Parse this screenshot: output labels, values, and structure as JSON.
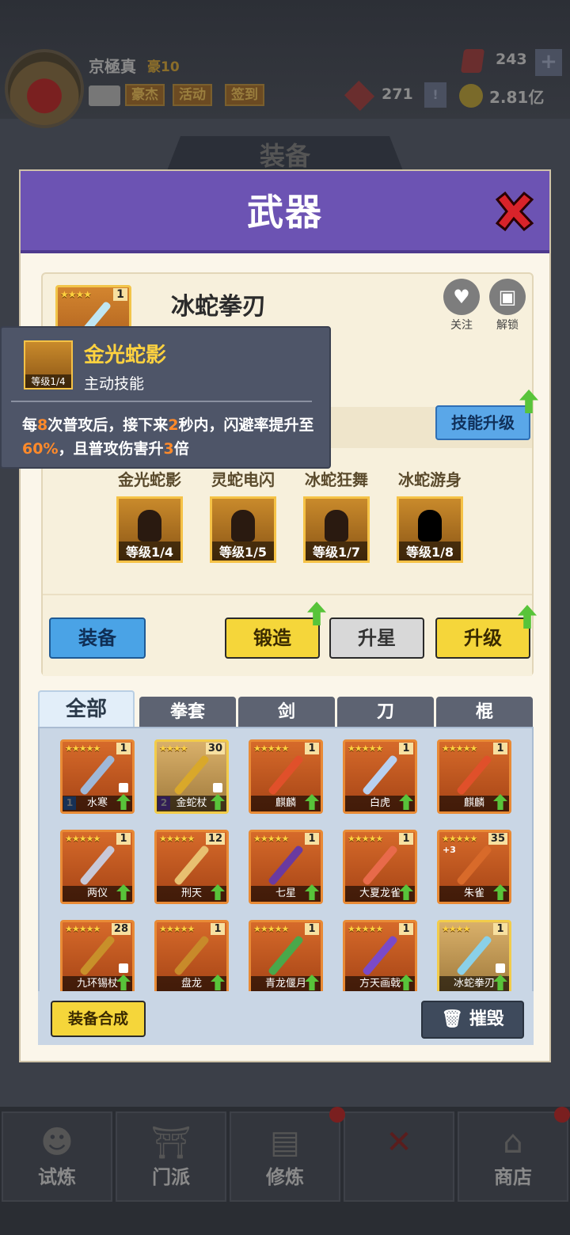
{
  "player": {
    "name": "京極真",
    "rank": "豪10",
    "tabs": [
      "豪杰",
      "活动",
      "签到"
    ]
  },
  "resources": {
    "gems": "243",
    "tickets": "271",
    "coins": "2.81亿"
  },
  "background": {
    "section_title": "装备",
    "nav": [
      "试炼",
      "门派",
      "修炼",
      "",
      "商店"
    ]
  },
  "modal": {
    "title": "武器",
    "item": {
      "name": "冰蛇拳刃",
      "stars": "★★★★",
      "qty": "1",
      "follow_label": "关注",
      "unlock_label": "解锁"
    },
    "skill_upgrade_label": "技能升级",
    "skills": [
      {
        "name": "金光蛇影",
        "level": "等级1/4"
      },
      {
        "name": "灵蛇电闪",
        "level": "等级1/5"
      },
      {
        "name": "冰蛇狂舞",
        "level": "等级1/7"
      },
      {
        "name": "冰蛇游身",
        "level": "等级1/8"
      }
    ],
    "buttons": {
      "equip": "装备",
      "forge": "锻造",
      "star": "升星",
      "upgrade": "升级"
    },
    "tabs": [
      "全部",
      "拳套",
      "剑",
      "刀",
      "棍"
    ],
    "weapons": [
      {
        "name": "水寒",
        "stars": "★★★★★",
        "qty": "1",
        "order": "1",
        "locked": true,
        "color": "#9fb8d8"
      },
      {
        "name": "金蛇杖",
        "stars": "★★★★",
        "qty": "30",
        "order": "2",
        "locked": true,
        "gold": true,
        "color": "#d9a82a"
      },
      {
        "name": "麒麟",
        "stars": "★★★★★",
        "qty": "1",
        "color": "#e0502a"
      },
      {
        "name": "白虎",
        "stars": "★★★★★",
        "qty": "1",
        "color": "#b8d0f0"
      },
      {
        "name": "麒麟",
        "stars": "★★★★★",
        "qty": "1",
        "color": "#e0502a"
      },
      {
        "name": "两仪",
        "stars": "★★★★★",
        "qty": "1",
        "color": "#c8c8d8"
      },
      {
        "name": "刑天",
        "stars": "★★★★★",
        "qty": "12",
        "color": "#e8c070"
      },
      {
        "name": "七星",
        "stars": "★★★★★",
        "qty": "1",
        "color": "#6a3aa0"
      },
      {
        "name": "大夏龙雀",
        "stars": "★★★★★",
        "qty": "1",
        "color": "#e86a4a"
      },
      {
        "name": "朱雀",
        "stars": "★★★★★",
        "qty": "35",
        "plus": "+3",
        "color": "#d86a2a"
      },
      {
        "name": "九环锡杖",
        "stars": "★★★★★",
        "qty": "28",
        "locked": true,
        "color": "#c8902a"
      },
      {
        "name": "盘龙",
        "stars": "★★★★★",
        "qty": "1",
        "color": "#c88a2a"
      },
      {
        "name": "青龙偃月",
        "stars": "★★★★★",
        "qty": "1",
        "color": "#4aa84a"
      },
      {
        "name": "方天画戟",
        "stars": "★★★★★",
        "qty": "1",
        "color": "#7a4ac8"
      },
      {
        "name": "冰蛇拳刃",
        "stars": "★★★★",
        "qty": "1",
        "locked": true,
        "gold": true,
        "color": "#8ad0e8"
      }
    ],
    "footer": {
      "synth": "装备合成",
      "destroy": "摧毁"
    }
  },
  "tooltip": {
    "title": "金光蛇影",
    "level": "等级1/4",
    "type": "主动技能",
    "desc_parts": [
      "每",
      "8",
      "次普攻后，接下来",
      "2",
      "秒内，闪避率提升至",
      "60%",
      "，且普攻伤害升",
      "3",
      "倍"
    ]
  },
  "colors": {
    "header": "#6c53b3",
    "highlight": "#ff8a2a",
    "tooltip_title": "#ffd23f"
  }
}
